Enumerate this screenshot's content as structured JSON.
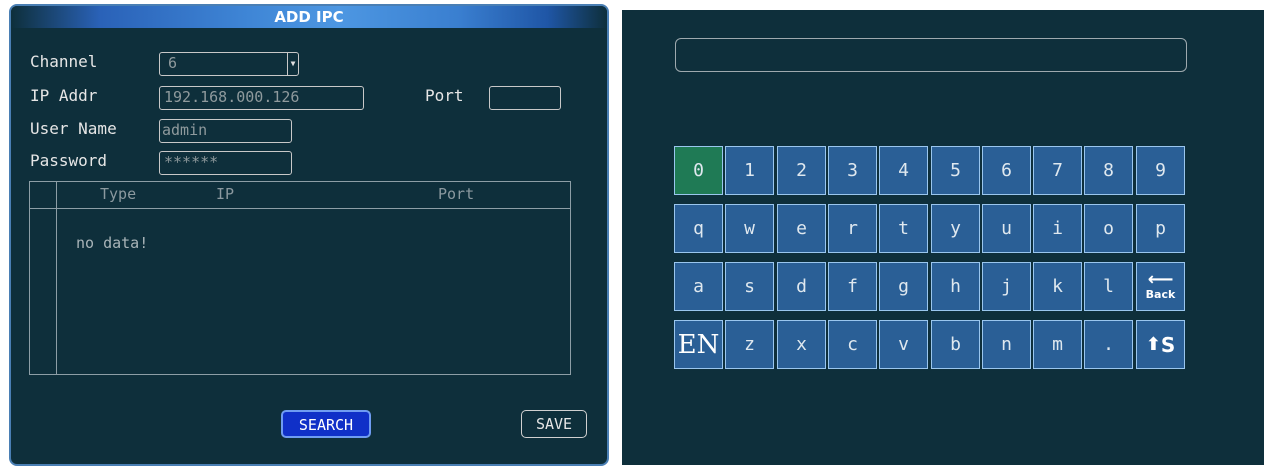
{
  "dialog": {
    "title": "ADD IPC",
    "labels": {
      "channel": "Channel",
      "ip": "IP Addr",
      "port": "Port",
      "user": "User Name",
      "password": "Password"
    },
    "values": {
      "channel": "6",
      "ip": "192.168.000.126",
      "port": "",
      "user": "admin",
      "password": "******"
    },
    "table": {
      "headers": [
        "Type",
        "IP",
        "Port"
      ],
      "empty_message": "no data!"
    },
    "buttons": {
      "search": "SEARCH",
      "save": "SAVE"
    }
  },
  "keyboard": {
    "input_value": "",
    "rows": [
      [
        "0",
        "1",
        "2",
        "3",
        "4",
        "5",
        "6",
        "7",
        "8",
        "9"
      ],
      [
        "q",
        "w",
        "e",
        "r",
        "t",
        "y",
        "u",
        "i",
        "o",
        "p"
      ],
      [
        "a",
        "s",
        "d",
        "f",
        "g",
        "h",
        "j",
        "k",
        "l"
      ],
      [
        "z",
        "x",
        "c",
        "v",
        "b",
        "n",
        "m",
        "."
      ]
    ],
    "back_label": "Back",
    "lang_label": "EN",
    "shift_label": "S",
    "selected_key": "0"
  },
  "colors": {
    "panel_bg": "#0e2f3b",
    "key_bg": "#2a5f96",
    "key_selected": "#1f7a55",
    "search_btn": "#1030c8"
  },
  "icons": {
    "back": "back-arrow-icon",
    "shift": "shift-arrow-icon",
    "dropdown": "chevron-down-icon"
  }
}
